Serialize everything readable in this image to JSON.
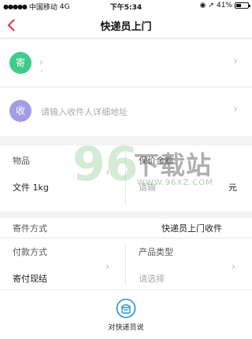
{
  "status_bar": {
    "signal": "●●●●●",
    "carrier": "中国移动",
    "network": "4G",
    "time": "下午5:34",
    "battery": "41%"
  },
  "nav": {
    "title": "快递员上门",
    "back_icon": "back-chevron-icon"
  },
  "sender": {
    "badge": "寄",
    "badge_color": "#3ecb8b",
    "prefix": "›"
  },
  "receiver": {
    "badge": "收",
    "badge_color": "#a39de6",
    "placeholder": "请输入收件人详细地址"
  },
  "goods": {
    "item_label": "物品",
    "item_value": "文件 1kg",
    "insure_label": "保价金额",
    "insure_placeholder": "请输",
    "insure_unit": "元"
  },
  "method": {
    "send_label": "寄件方式",
    "send_value": "快递员上门收件",
    "pay_label": "付款方式",
    "pay_value": "寄付现结",
    "product_label": "产品类型",
    "product_placeholder": "请选择"
  },
  "footer": {
    "label": "对快递员说",
    "icon": "courier-icon"
  },
  "watermark": {
    "num": "96",
    "text": "下载站",
    "url": "WWW.96XZ.COM"
  }
}
